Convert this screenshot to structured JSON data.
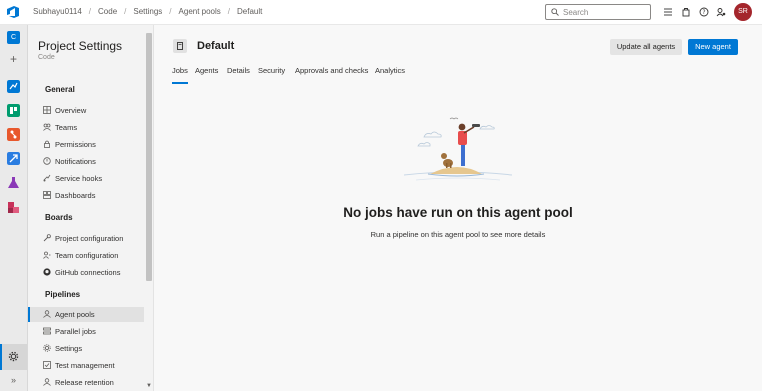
{
  "topbar": {
    "breadcrumbs": [
      "Subhayu0114",
      "Code",
      "Settings",
      "Agent pools",
      "Default"
    ],
    "search_placeholder": "Search",
    "avatar_initials": "SR"
  },
  "rail": {
    "project_initial": "C",
    "add_symbol": "+",
    "expand_symbol": "»"
  },
  "settings_panel": {
    "title": "Project Settings",
    "subtitle": "Code",
    "sections": [
      {
        "heading": "General",
        "items": [
          {
            "label": "Overview",
            "icon": "overview-icon"
          },
          {
            "label": "Teams",
            "icon": "teams-icon"
          },
          {
            "label": "Permissions",
            "icon": "lock-icon"
          },
          {
            "label": "Notifications",
            "icon": "bell-icon"
          },
          {
            "label": "Service hooks",
            "icon": "hook-icon"
          },
          {
            "label": "Dashboards",
            "icon": "dashboard-icon"
          }
        ]
      },
      {
        "heading": "Boards",
        "items": [
          {
            "label": "Project configuration",
            "icon": "config-icon"
          },
          {
            "label": "Team configuration",
            "icon": "team-config-icon"
          },
          {
            "label": "GitHub connections",
            "icon": "github-icon"
          }
        ]
      },
      {
        "heading": "Pipelines",
        "items": [
          {
            "label": "Agent pools",
            "icon": "agent-pool-icon",
            "active": true
          },
          {
            "label": "Parallel jobs",
            "icon": "parallel-icon"
          },
          {
            "label": "Settings",
            "icon": "gear-icon"
          },
          {
            "label": "Test management",
            "icon": "test-icon"
          },
          {
            "label": "Release retention",
            "icon": "retention-icon"
          }
        ]
      }
    ]
  },
  "main": {
    "pool_title": "Default",
    "update_button": "Update all agents",
    "new_button": "New agent",
    "tabs": [
      "Jobs",
      "Agents",
      "Details",
      "Security",
      "Approvals and checks",
      "Analytics"
    ],
    "active_tab": "Jobs",
    "empty_title": "No jobs have run on this agent pool",
    "empty_subtitle": "Run a pipeline on this agent pool to see more details"
  },
  "colors": {
    "accent": "#0078d4",
    "avatar": "#a4262c"
  }
}
